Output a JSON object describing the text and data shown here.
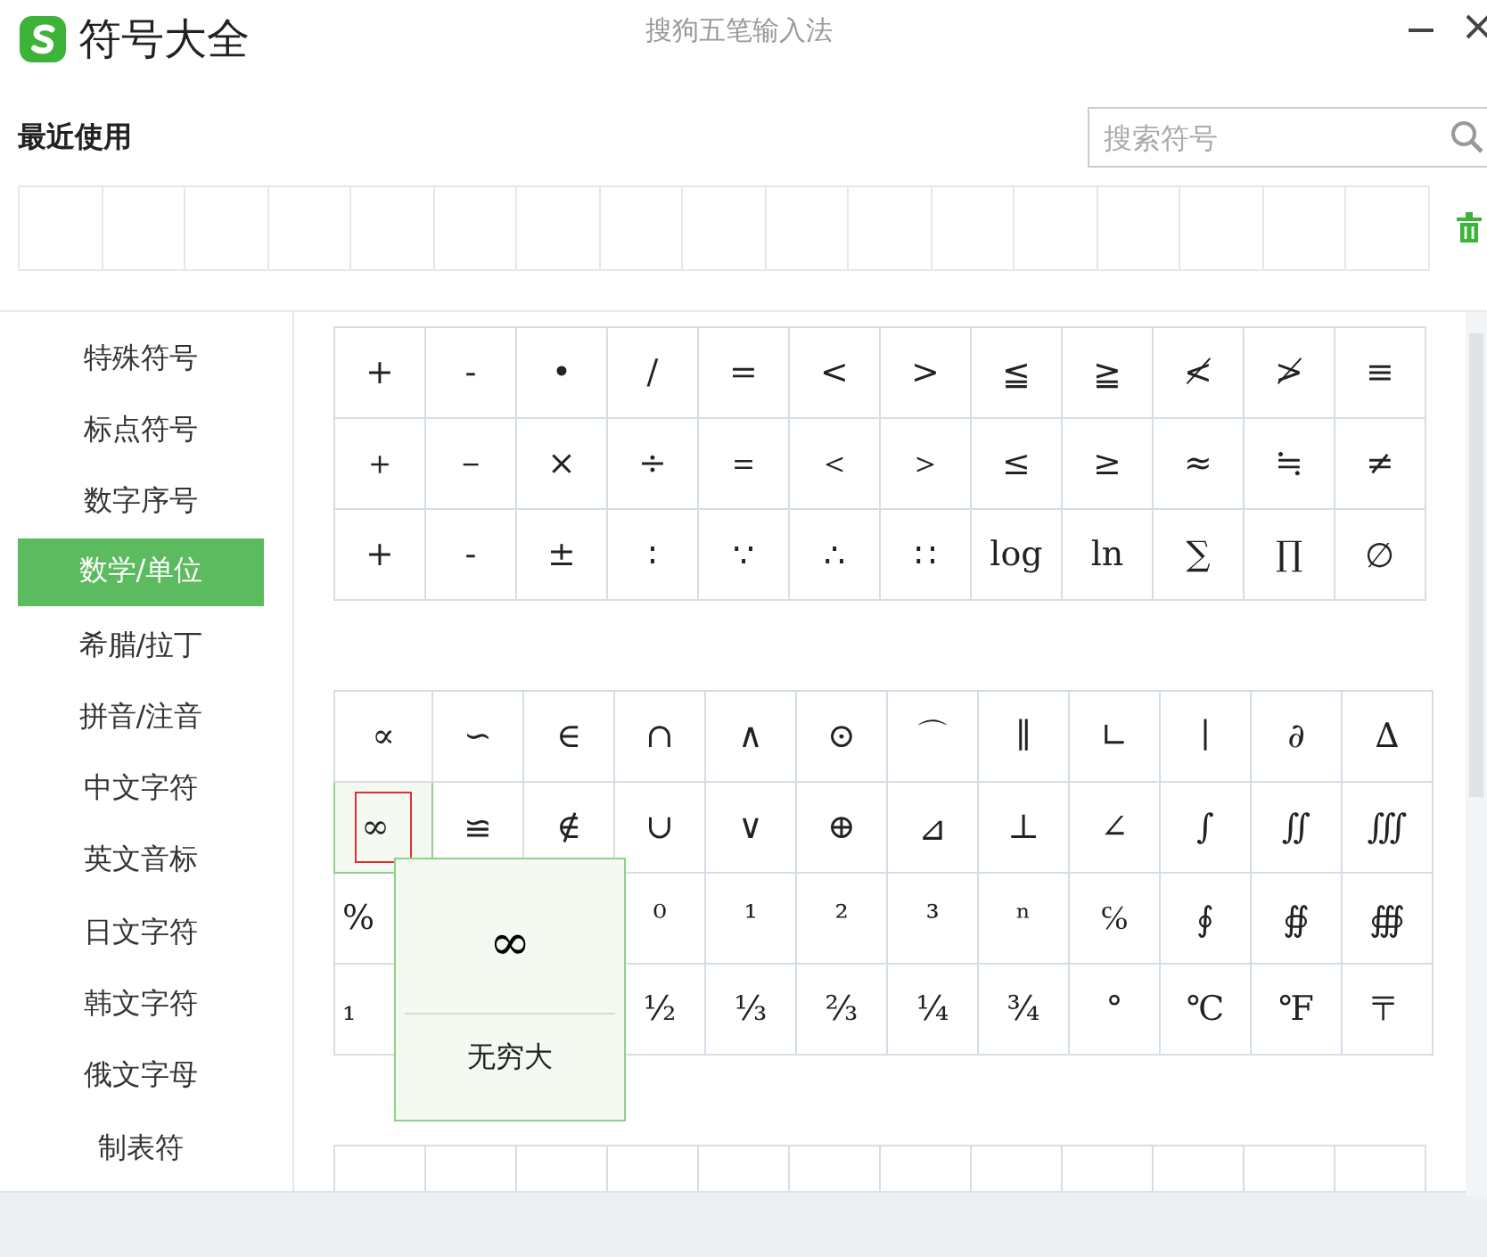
{
  "window": {
    "title": "符号大全",
    "subtitle": "搜狗五笔输入法"
  },
  "recent": {
    "label": "最近使用"
  },
  "search": {
    "placeholder": "搜索符号"
  },
  "sidebar": {
    "items": [
      {
        "label": "特殊符号",
        "selected": false
      },
      {
        "label": "标点符号",
        "selected": false
      },
      {
        "label": "数字序号",
        "selected": false
      },
      {
        "label": "数学/单位",
        "selected": true
      },
      {
        "label": "希腊/拉丁",
        "selected": false
      },
      {
        "label": "拼音/注音",
        "selected": false
      },
      {
        "label": "中文字符",
        "selected": false
      },
      {
        "label": "英文音标",
        "selected": false
      },
      {
        "label": "日文字符",
        "selected": false
      },
      {
        "label": "韩文字符",
        "selected": false
      },
      {
        "label": "俄文字母",
        "selected": false
      },
      {
        "label": "制表符",
        "selected": false
      }
    ]
  },
  "groups": [
    {
      "rows": [
        [
          {
            "symbol": "+",
            "selected": false
          },
          {
            "symbol": "-",
            "selected": false
          },
          {
            "symbol": "•",
            "selected": false
          },
          {
            "symbol": "/",
            "selected": false
          },
          {
            "symbol": "=",
            "selected": false
          },
          {
            "symbol": "<",
            "selected": false
          },
          {
            "symbol": ">",
            "selected": false
          },
          {
            "symbol": "≦",
            "selected": false
          },
          {
            "symbol": "≧",
            "selected": false
          },
          {
            "symbol": "≮",
            "selected": false
          },
          {
            "symbol": "≯",
            "selected": false
          },
          {
            "symbol": "≡",
            "selected": false
          }
        ],
        [
          {
            "symbol": "＋",
            "selected": false
          },
          {
            "symbol": "－",
            "selected": false
          },
          {
            "symbol": "×",
            "selected": false
          },
          {
            "symbol": "÷",
            "selected": false
          },
          {
            "symbol": "＝",
            "selected": false
          },
          {
            "symbol": "＜",
            "selected": false
          },
          {
            "symbol": "＞",
            "selected": false
          },
          {
            "symbol": "≤",
            "selected": false
          },
          {
            "symbol": "≥",
            "selected": false
          },
          {
            "symbol": "≈",
            "selected": false
          },
          {
            "symbol": "≒",
            "selected": false
          },
          {
            "symbol": "≠",
            "selected": false
          }
        ],
        [
          {
            "symbol": "+",
            "selected": false
          },
          {
            "symbol": "-",
            "selected": false
          },
          {
            "symbol": "±",
            "selected": false
          },
          {
            "symbol": "∶",
            "selected": false
          },
          {
            "symbol": "∵",
            "selected": false
          },
          {
            "symbol": "∴",
            "selected": false
          },
          {
            "symbol": "∷",
            "selected": false
          },
          {
            "symbol": "log",
            "selected": false
          },
          {
            "symbol": "ln",
            "selected": false
          },
          {
            "symbol": "∑",
            "selected": false
          },
          {
            "symbol": "∏",
            "selected": false
          },
          {
            "symbol": "∅",
            "selected": false
          }
        ]
      ]
    },
    {
      "rows": [
        [
          {
            "symbol": "∝",
            "selected": false
          },
          {
            "symbol": "∽",
            "selected": false
          },
          {
            "symbol": "∈",
            "selected": false
          },
          {
            "symbol": "∩",
            "selected": false
          },
          {
            "symbol": "∧",
            "selected": false
          },
          {
            "symbol": "⊙",
            "selected": false
          },
          {
            "symbol": "⌒",
            "selected": false
          },
          {
            "symbol": "∥",
            "selected": false
          },
          {
            "symbol": "∟",
            "selected": false
          },
          {
            "symbol": "∣",
            "selected": false
          },
          {
            "symbol": "∂",
            "selected": false
          },
          {
            "symbol": "∆",
            "selected": false
          }
        ],
        [
          {
            "symbol": "∞",
            "selected": true
          },
          {
            "symbol": "≌",
            "selected": false
          },
          {
            "symbol": "∉",
            "selected": false
          },
          {
            "symbol": "∪",
            "selected": false
          },
          {
            "symbol": "∨",
            "selected": false
          },
          {
            "symbol": "⊕",
            "selected": false
          },
          {
            "symbol": "⊿",
            "selected": false
          },
          {
            "symbol": "⊥",
            "selected": false
          },
          {
            "symbol": "∠",
            "selected": false
          },
          {
            "symbol": "∫",
            "selected": false
          },
          {
            "symbol": "∬",
            "selected": false
          },
          {
            "symbol": "∭",
            "selected": false
          }
        ],
        [
          {
            "symbol": "%",
            "selected": false
          },
          null,
          null,
          {
            "symbol": "⁰",
            "selected": false
          },
          {
            "symbol": "¹",
            "selected": false
          },
          {
            "symbol": "²",
            "selected": false
          },
          {
            "symbol": "³",
            "selected": false
          },
          {
            "symbol": "ⁿ",
            "selected": false
          },
          {
            "symbol": "℅",
            "selected": false
          },
          {
            "symbol": "∮",
            "selected": false
          },
          {
            "symbol": "∯",
            "selected": false
          },
          {
            "symbol": "∰",
            "selected": false
          }
        ],
        [
          {
            "symbol": "₁",
            "selected": false
          },
          null,
          null,
          {
            "symbol": "½",
            "selected": false
          },
          {
            "symbol": "⅓",
            "selected": false
          },
          {
            "symbol": "⅔",
            "selected": false
          },
          {
            "symbol": "¼",
            "selected": false
          },
          {
            "symbol": "¾",
            "selected": false
          },
          {
            "symbol": "°",
            "selected": false
          },
          {
            "symbol": "℃",
            "selected": false
          },
          {
            "symbol": "℉",
            "selected": false
          },
          {
            "symbol": "〒",
            "selected": false
          }
        ]
      ]
    }
  ],
  "tooltip": {
    "symbol": "∞",
    "name": "无穷大"
  }
}
